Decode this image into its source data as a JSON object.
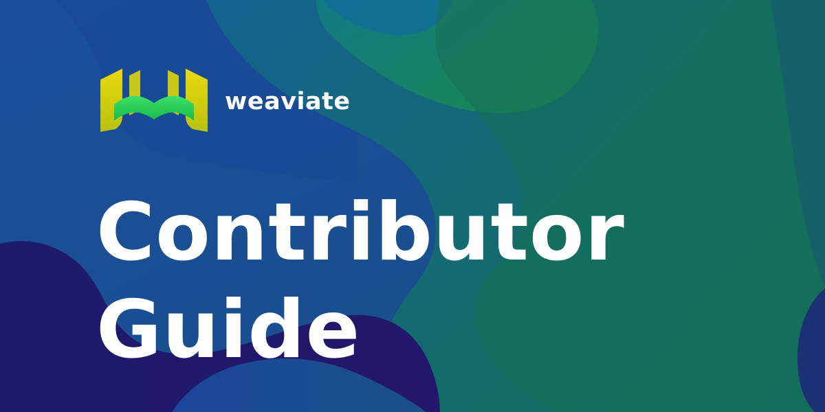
{
  "brand": {
    "name": "weaviate",
    "logo_icon": "weaviate-w-logo-icon"
  },
  "headline": {
    "line1": "Contributor",
    "line2": "Guide"
  },
  "colors": {
    "text": "#ffffff",
    "logo_yellow": "#e4d20c",
    "logo_green": "#2bd65c",
    "background_blue": "#1a4a9a",
    "background_teal": "#156a6a",
    "background_deep": "#1f1868"
  }
}
